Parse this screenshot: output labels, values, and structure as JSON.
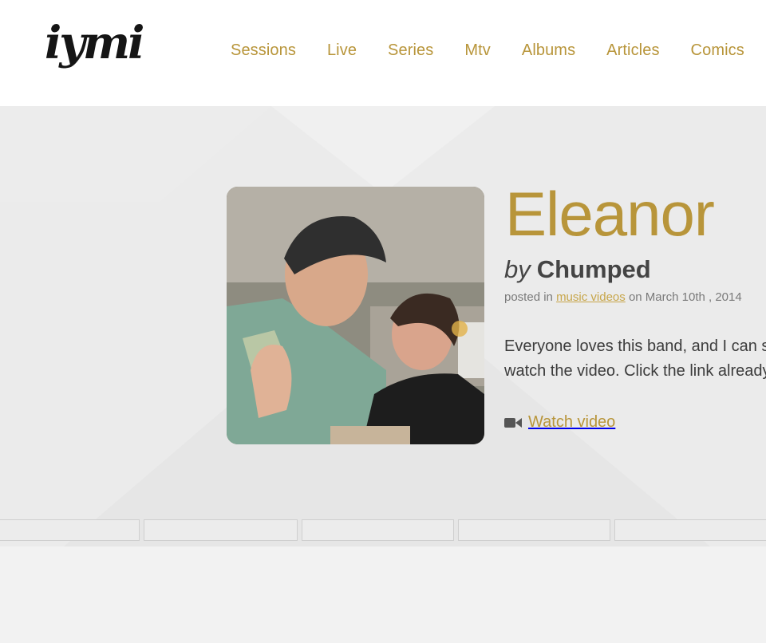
{
  "brand": {
    "logo_text": "iymi"
  },
  "nav": {
    "items": [
      "Sessions",
      "Live",
      "Series",
      "Mtv",
      "Albums",
      "Articles",
      "Comics"
    ]
  },
  "post": {
    "title": "Eleanor",
    "by_label": "by",
    "artist": "Chumped",
    "posted_prefix": "posted in",
    "category": "music videos",
    "date_text": "on March 10th , 2014",
    "description_line1": "Everyone loves this band, and I can se",
    "description_line2": "watch the video. Click the link already",
    "watch_label": "Watch video",
    "watch_icon": "video-camera-icon",
    "photo_alt": "video still"
  },
  "colors": {
    "accent": "#b8953a",
    "category": "#c7a64a",
    "text": "#3c3c3c",
    "hero_bg": "#ebebeb",
    "page_bg": "#f2f2f2"
  }
}
